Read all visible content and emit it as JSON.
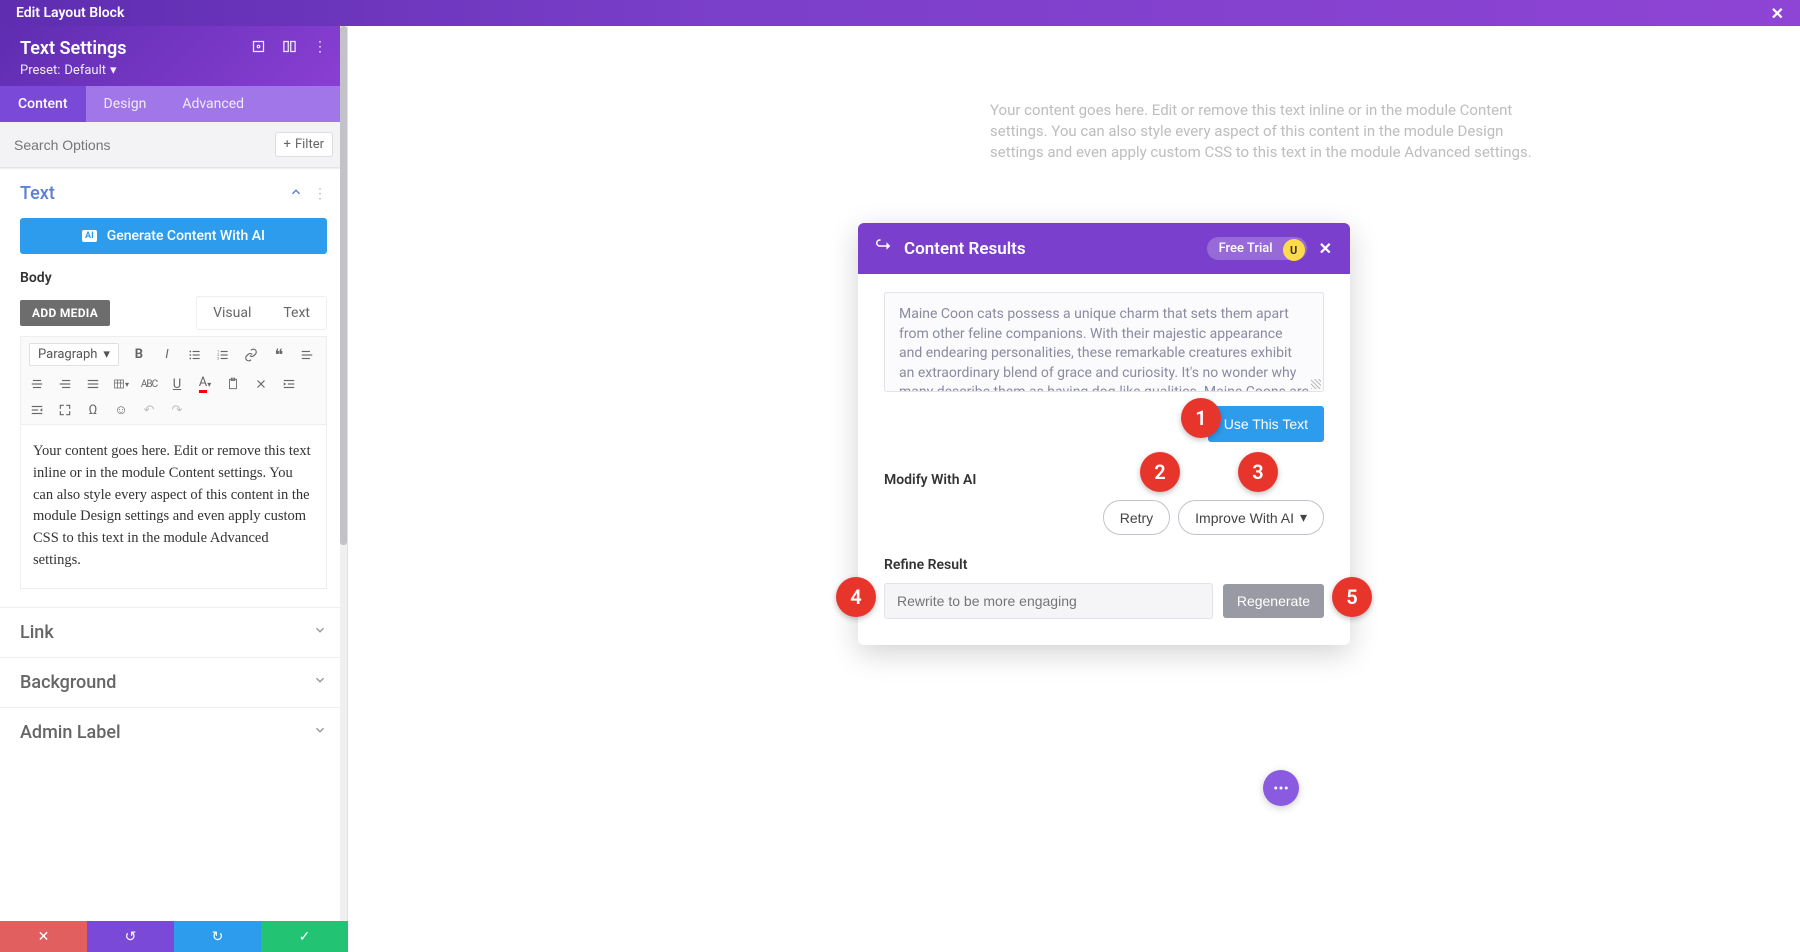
{
  "topBanner": {
    "title": "Edit Layout Block"
  },
  "sidebar": {
    "title": "Text Settings",
    "preset_label": "Preset:",
    "preset_value": "Default",
    "tabs": {
      "content": "Content",
      "design": "Design",
      "advanced": "Advanced"
    },
    "search_placeholder": "Search Options",
    "filter_label": "Filter",
    "sections": {
      "text": "Text",
      "link": "Link",
      "background": "Background",
      "admin": "Admin Label"
    },
    "generate_btn": "Generate Content With AI",
    "body_label": "Body",
    "add_media": "ADD MEDIA",
    "rte_tabs": {
      "visual": "Visual",
      "text": "Text"
    },
    "paragraph_label": "Paragraph",
    "editor_content": "Your content goes here. Edit or remove this text inline or in the module Content settings. You can also style every aspect of this content in the module Design settings and even apply custom CSS to this text in the module Advanced settings."
  },
  "canvas": {
    "placeholder_text": "Your content goes here. Edit or remove this text inline or in the module Content settings. You can also style every aspect of this content in the module Design settings and even apply custom CSS to this text in the module Advanced settings."
  },
  "dialog": {
    "title": "Content Results",
    "free_trial": "Free Trial",
    "yellow_char": "U",
    "result_text": "Maine Coon cats possess a unique charm that sets them apart from other feline companions. With their majestic appearance and endearing personalities, these remarkable creatures exhibit an extraordinary blend of grace and curiosity. It's no wonder why many describe them as having dog-like qualities. Maine Coons are known for their affectionate nature, often greeting their owners at the door and following them around the house",
    "use_btn": "Use This Text",
    "modify_label": "Modify With AI",
    "retry_btn": "Retry",
    "improve_btn": "Improve With AI",
    "refine_label": "Refine Result",
    "refine_placeholder": "Rewrite to be more engaging",
    "regenerate_btn": "Regenerate"
  },
  "callouts": {
    "c1": "1",
    "c2": "2",
    "c3": "3",
    "c4": "4",
    "c5": "5"
  }
}
